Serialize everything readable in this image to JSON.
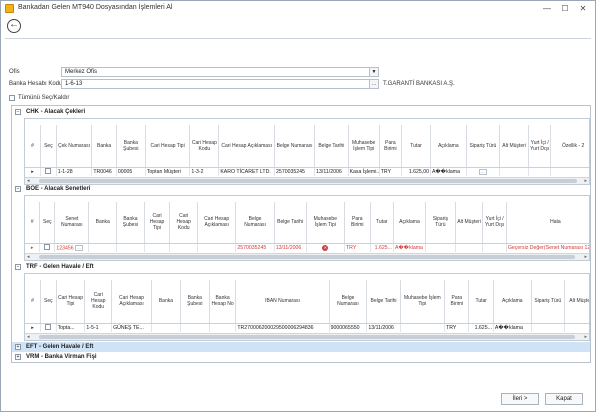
{
  "window": {
    "title": "Bankadan Gelen MT940 Dosyasından İşlemleri Al",
    "minimize": "—",
    "maximize": "☐",
    "close": "✕"
  },
  "form": {
    "ofis_label": "Ofis",
    "ofis_value": "Merkez Ofis",
    "banka_label": "Banka Hesabı Kodu",
    "banka_value": "1-6-13",
    "banka_name": "T.GARANTİ BANKASI A.Ş.",
    "select_all_label": "Tümünü Seç/Kaldır"
  },
  "sections": {
    "chk": {
      "title": "CHK - Alacak Çekleri",
      "headers": [
        "#",
        "Seç",
        "Çek Numarası",
        "Banka",
        "Banka Şubesi",
        "Cari Hesap Tipi",
        "Cari Hesap Kodu",
        "Cari Hesap Açıklaması",
        "Belge Numarası",
        "Belge Tarihi",
        "Muhasebe İşlem Tipi",
        "Para Birimi",
        "Tutar",
        "Açıklama",
        "Sipariş Türü",
        "Alt Müşteri",
        "Yurt İçi / Yurt Dışı",
        "Özellik - 2",
        "Özellik"
      ],
      "row": [
        "",
        "",
        "1-1-28",
        "TR0046",
        "00005",
        "Toptan Müşteri",
        "1-3-2",
        "KARO TİCARET LTD.",
        "2570035245",
        "13/11/2006",
        "Kasa İşlemi...",
        "TRY",
        "1.625,00",
        "A��klama",
        "",
        "",
        "",
        "",
        ""
      ]
    },
    "boe": {
      "title": "BOE - Alacak Senetleri",
      "headers": [
        "#",
        "Seç",
        "Senet Numarası",
        "Banka",
        "Banka Şubesi",
        "Cari Hesap Tipi",
        "Cari Hesap Kodu",
        "Cari Hesap Açıklaması",
        "Belge Numarası",
        "Belge Tarihi",
        "Muhasebe İşlem Tipi",
        "Para Birimi",
        "Tutar",
        "Açıklama",
        "Sipariş Türü",
        "Alt Müşteri",
        "Yurt İçi / Yurt Dışı",
        "Hata"
      ],
      "row": [
        "",
        "",
        "123456",
        "",
        "",
        "",
        "",
        "",
        "2570035245",
        "13/11/2006",
        "",
        "TRY",
        "1.625...",
        "A��klama",
        "",
        "",
        "",
        "Geçersiz Değer(Senet Numarası 123"
      ]
    },
    "trf": {
      "title": "TRF - Gelen Havale / Eft",
      "headers": [
        "#",
        "Seç",
        "Cari Hesap Tipi",
        "Cari Hesap Kodu",
        "Cari Hesap Açıklaması",
        "Banka",
        "Banka Şubesi",
        "Banka Hesap No",
        "IBAN Numarası",
        "Belge Numarası",
        "Belge Tarihi",
        "Muhasebe İşlem Tipi",
        "Para Birimi",
        "Tutar",
        "Açıklama",
        "Sipariş Türü",
        "Alt Müşteri",
        "Yurt İçi / Yurt Dışı"
      ],
      "row": [
        "",
        "",
        "Topta...",
        "1-5-1",
        "GÜNEŞ TE...",
        "",
        "",
        "",
        "TR270006200029500006294836",
        "9000065550",
        "13/11/2006",
        "",
        "TRY",
        "1.625...",
        "A��klama",
        "",
        "",
        ""
      ]
    },
    "eft": {
      "title": "EFT - Gelen Havale / Eft"
    },
    "vrm": {
      "title": "VRM - Banka Virman Fişi"
    }
  },
  "buttons": {
    "next": "İleri >",
    "cancel": "Kapat"
  }
}
